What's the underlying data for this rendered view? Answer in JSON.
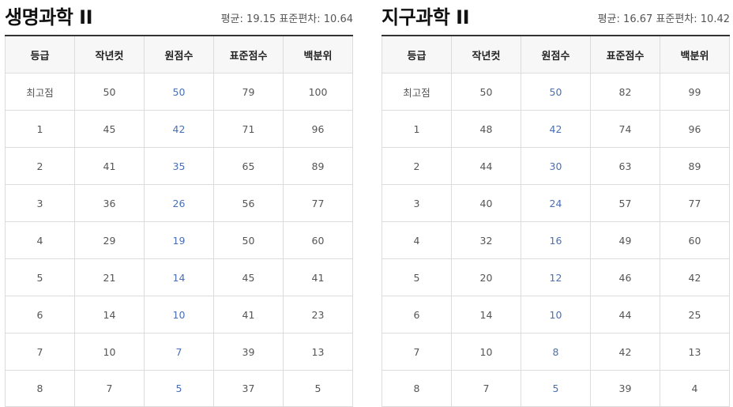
{
  "columns": [
    "등급",
    "작년컷",
    "원점수",
    "표준점수",
    "백분위"
  ],
  "panels": [
    {
      "title": "생명과학 II",
      "mean_label": "평균:",
      "mean": "19.15",
      "sd_label": "표준편차:",
      "sd": "10.64",
      "rows": [
        [
          "최고점",
          "50",
          "50",
          "79",
          "100"
        ],
        [
          "1",
          "45",
          "42",
          "71",
          "96"
        ],
        [
          "2",
          "41",
          "35",
          "65",
          "89"
        ],
        [
          "3",
          "36",
          "26",
          "56",
          "77"
        ],
        [
          "4",
          "29",
          "19",
          "50",
          "60"
        ],
        [
          "5",
          "21",
          "14",
          "45",
          "41"
        ],
        [
          "6",
          "14",
          "10",
          "41",
          "23"
        ],
        [
          "7",
          "10",
          "7",
          "39",
          "13"
        ],
        [
          "8",
          "7",
          "5",
          "37",
          "5"
        ]
      ]
    },
    {
      "title": "지구과학 II",
      "mean_label": "평균:",
      "mean": "16.67",
      "sd_label": "표준편차:",
      "sd": "10.42",
      "rows": [
        [
          "최고점",
          "50",
          "50",
          "82",
          "99"
        ],
        [
          "1",
          "48",
          "42",
          "74",
          "96"
        ],
        [
          "2",
          "44",
          "30",
          "63",
          "89"
        ],
        [
          "3",
          "40",
          "24",
          "57",
          "77"
        ],
        [
          "4",
          "32",
          "16",
          "49",
          "60"
        ],
        [
          "5",
          "20",
          "12",
          "46",
          "42"
        ],
        [
          "6",
          "14",
          "10",
          "44",
          "25"
        ],
        [
          "7",
          "10",
          "8",
          "42",
          "13"
        ],
        [
          "8",
          "7",
          "5",
          "39",
          "4"
        ]
      ]
    }
  ],
  "colors": {
    "raw_score": "#4a6fb5",
    "header_bg": "#f7f7f7",
    "border": "#dcdcdc"
  }
}
